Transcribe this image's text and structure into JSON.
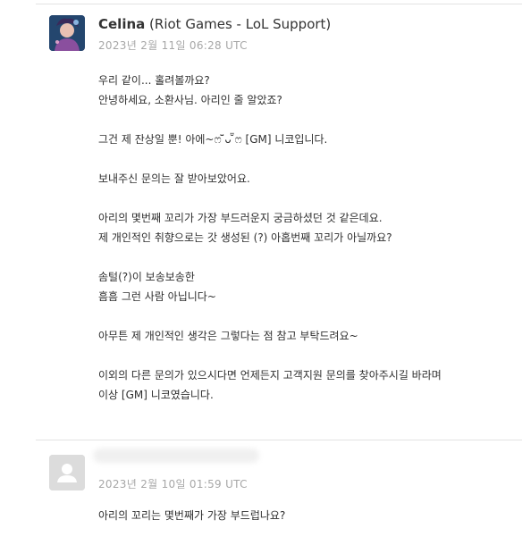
{
  "agent_comment": {
    "author_name": "Celina",
    "author_role": "(Riot Games - LoL Support)",
    "timestamp": "2023년 2월 11일 06:28 UTC",
    "paragraphs": [
      [
        "우리 같이... 홀려볼까요?",
        "안녕하세요, 소환사님. 아리인 줄 알았죠?"
      ],
      [
        "그건 제 잔상일 뿐! 아에~ෆ ̆̈ᴗ ̆̈ෆ [GM] 니코입니다."
      ],
      [
        "보내주신 문의는 잘 받아보았어요."
      ],
      [
        "아리의 몇번째 꼬리가 가장 부드러운지 궁금하셨던 것 같은데요.",
        "제 개인적인 취향으로는 갓 생성된 (?) 아홉번째 꼬리가 아닐까요?"
      ],
      [
        "솜털(?)이 보송보송한",
        "흠흠 그런 사람 아닙니다~"
      ],
      [
        "아무튼 제 개인적인 생각은 그렇다는 점 참고 부탁드려요~"
      ],
      [
        "이외의 다른 문의가 있으시다면 언제든지 고객지원 문의를 찾아주시길 바라며",
        "이상 [GM] 니코였습니다."
      ]
    ]
  },
  "user_comment": {
    "timestamp": "2023년 2월 10일 01:59 UTC",
    "paragraphs": [
      [
        "아리의 꼬리는 몇번째가 가장 부드럽나요?"
      ]
    ]
  },
  "icons": {
    "agent_avatar": "agent-avatar-image",
    "user_avatar": "default-user-avatar-icon"
  }
}
